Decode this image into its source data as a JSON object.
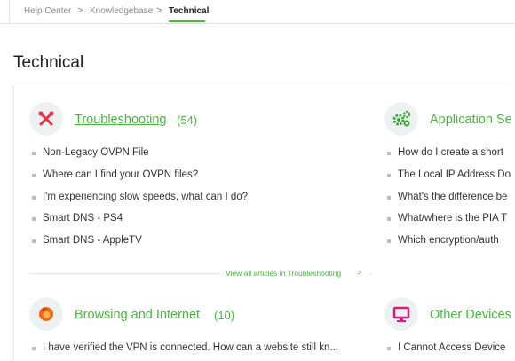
{
  "breadcrumb": {
    "items": [
      "Help Center",
      "Knowledgebase",
      "Technical"
    ],
    "separator": ">"
  },
  "page_title": "Technical",
  "categories": [
    {
      "title": "Troubleshooting",
      "count": "(54)",
      "icon": "tools-icon",
      "articles": [
        "Non-Legacy OVPN File",
        "Where can I find your OVPN files?",
        "I'm experiencing slow speeds, what can I do?",
        "Smart DNS - PS4",
        "Smart DNS - AppleTV"
      ],
      "view_all": "View all articles in Troubleshooting",
      "view_all_arrow": ">"
    },
    {
      "title": "Application Se",
      "count": "",
      "icon": "gears-icon",
      "articles": [
        "How do I create a short",
        "The Local IP Address Do",
        "What's the difference be",
        "What/where is the PIA T",
        "Which encryption/auth"
      ]
    },
    {
      "title": "Browsing and Internet",
      "count": "(10)",
      "icon": "firefox-icon",
      "articles": [
        "I have verified the VPN is connected. How can a website still kn..."
      ]
    },
    {
      "title": "Other Devices",
      "count": "",
      "icon": "monitor-icon",
      "articles": [
        "I Cannot Access Device"
      ]
    }
  ],
  "colors": {
    "accent": "#4bb543",
    "icon_red": "#e8324a",
    "icon_green": "#3aa935",
    "icon_orange": "#f06a1d",
    "icon_pink": "#d61c7a",
    "icon_bg": "#eef1f2"
  }
}
